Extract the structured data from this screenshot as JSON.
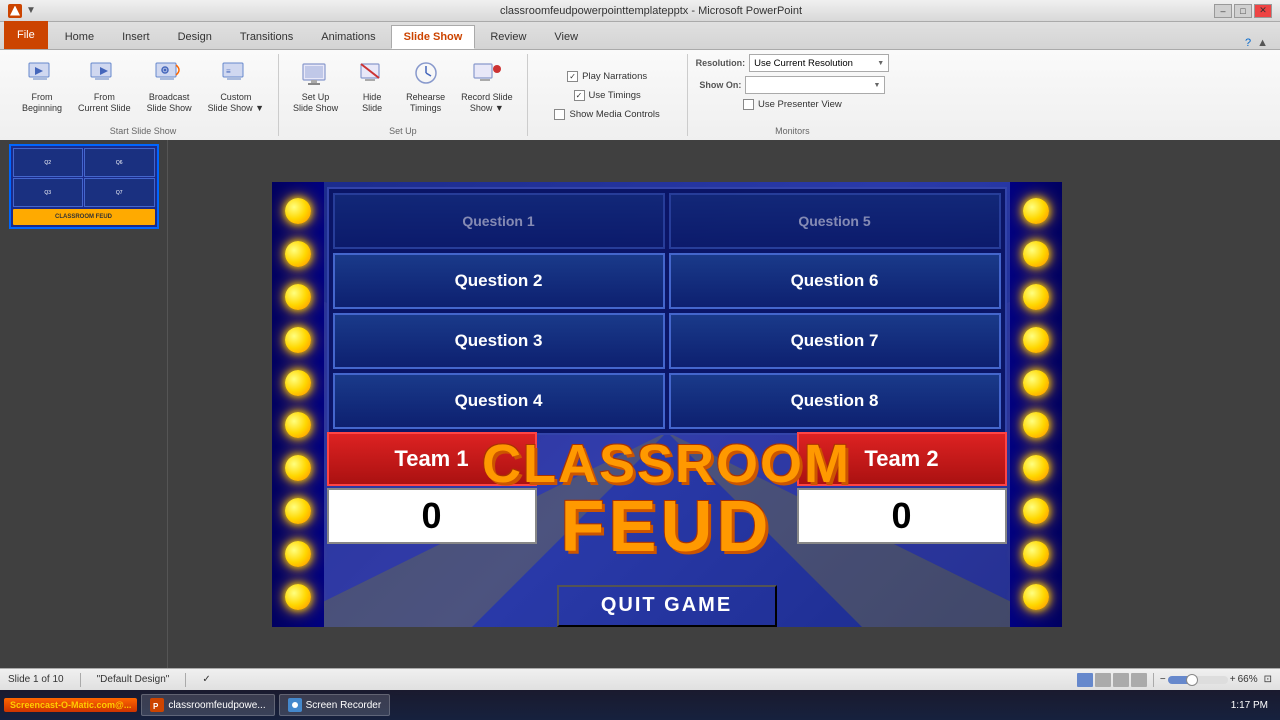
{
  "titlebar": {
    "title": "classroomfeudpowerpointtemplatepptx - Microsoft PowerPoint",
    "minimize": "–",
    "restore": "□",
    "close": "✕"
  },
  "tabs": [
    {
      "label": "File",
      "active": false,
      "type": "file"
    },
    {
      "label": "Home",
      "active": false
    },
    {
      "label": "Insert",
      "active": false
    },
    {
      "label": "Design",
      "active": false
    },
    {
      "label": "Transitions",
      "active": false
    },
    {
      "label": "Animations",
      "active": false
    },
    {
      "label": "Slide Show",
      "active": true
    },
    {
      "label": "Review",
      "active": false
    },
    {
      "label": "View",
      "active": false
    }
  ],
  "ribbon": {
    "groups": {
      "start_slideshow": {
        "label": "Start Slide Show",
        "buttons": [
          {
            "id": "from-beginning",
            "label": "From\nBeginning"
          },
          {
            "id": "from-current",
            "label": "From\nCurrent Slide"
          },
          {
            "id": "broadcast",
            "label": "Broadcast\nSlide Show"
          },
          {
            "id": "custom",
            "label": "Custom\nSlide Show"
          }
        ]
      },
      "setup": {
        "label": "Set Up",
        "buttons": [
          {
            "id": "setup-slideshow",
            "label": "Set Up\nSlide Show"
          },
          {
            "id": "hide-slide",
            "label": "Hide\nSlide"
          },
          {
            "id": "rehearse-timings",
            "label": "Rehearse\nTimings"
          },
          {
            "id": "record-slide",
            "label": "Record Slide\nShow"
          }
        ]
      },
      "checkboxes": [
        {
          "label": "Play Narrations",
          "checked": true
        },
        {
          "label": "Use Timings",
          "checked": true
        },
        {
          "label": "Show Media Controls",
          "checked": false
        }
      ],
      "monitors": {
        "label": "Monitors",
        "resolution_label": "Resolution:",
        "resolution_value": "Use Current Resolution",
        "show_on_label": "Show On:",
        "show_on_value": "",
        "presenter_view_label": "Use Presenter View",
        "presenter_checked": false
      }
    }
  },
  "slide": {
    "questions": [
      "Question 1",
      "Question 5",
      "Question 2",
      "Question 6",
      "Question 3",
      "Question 7",
      "Question 4",
      "Question 8"
    ],
    "logo_line1": "CLASSROOM",
    "logo_line2": "FEUD",
    "team1_label": "Team 1",
    "team2_label": "Team 2",
    "team1_score": "0",
    "team2_score": "0",
    "quit_label": "QUIT GAME"
  },
  "statusbar": {
    "slide_info": "Slide 1 of 10",
    "theme": "\"Default Design\"",
    "zoom": "66%"
  },
  "taskbar": {
    "screencast_label": "Screencast-O-Matic.com@...",
    "ppt_label": "classroomfeudpowe...",
    "recorder_label": "Screen Recorder",
    "time": "1:17 PM"
  }
}
